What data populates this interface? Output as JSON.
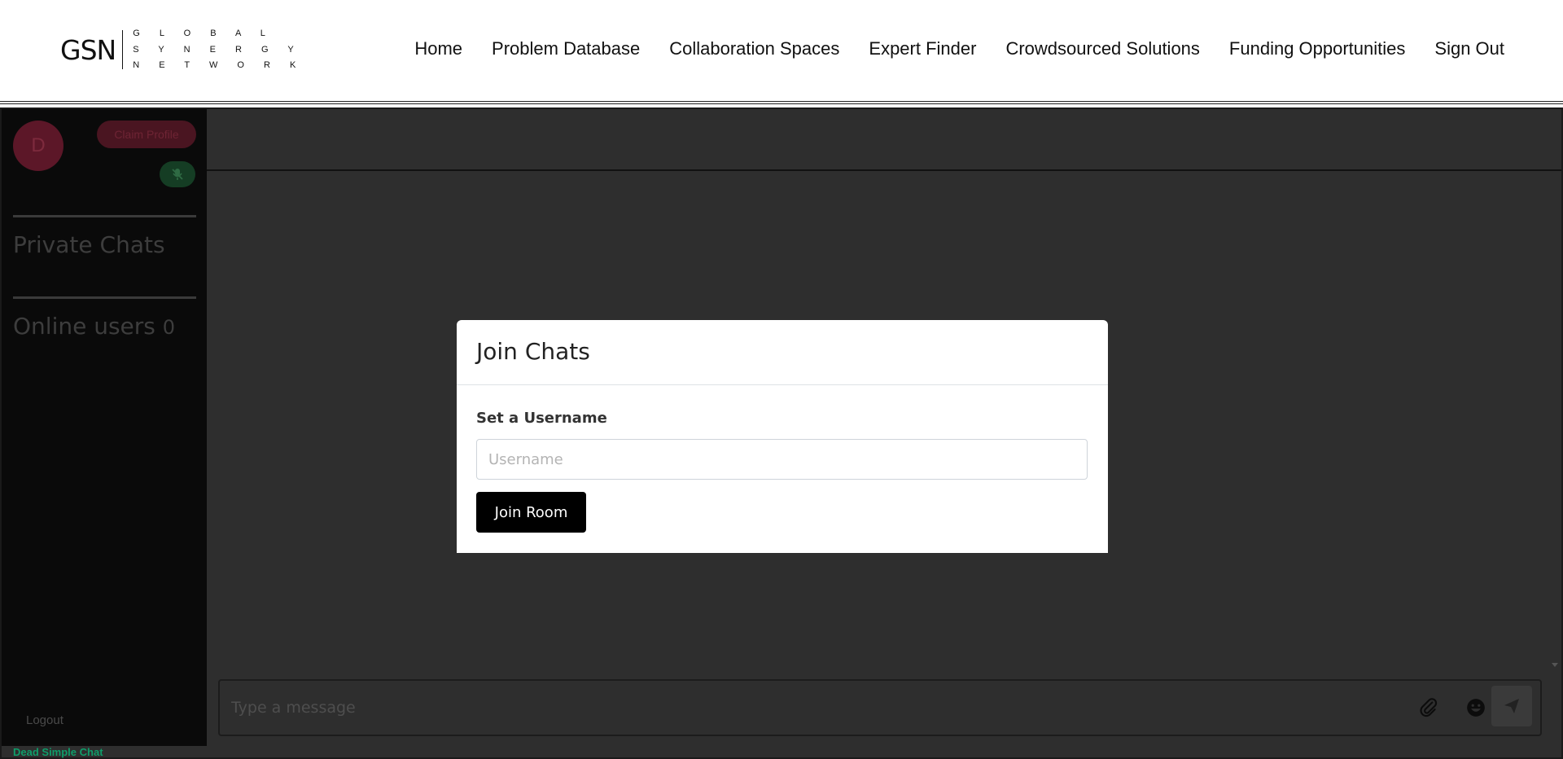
{
  "header": {
    "logo": {
      "abbr": "GSN",
      "words": [
        "G L O B A L",
        "S Y N E R G Y",
        "N E T W O R K"
      ]
    },
    "nav": [
      "Home",
      "Problem Database",
      "Collaboration Spaces",
      "Expert Finder",
      "Crowdsourced Solutions",
      "Funding Opportunities",
      "Sign Out"
    ]
  },
  "sidebar": {
    "avatar_letter": "D",
    "claim_profile": "Claim Profile",
    "private_chats": "Private Chats",
    "online_users_label": "Online users",
    "online_users_count": "0",
    "logout": "Logout",
    "brand": "Dead Simple Chat"
  },
  "composer": {
    "placeholder": "Type a message"
  },
  "modal": {
    "title": "Join Chats",
    "field_label": "Set a Username",
    "input_placeholder": "Username",
    "button": "Join Room"
  },
  "icons": {
    "mute": "microphone-slash-icon",
    "attach": "paperclip-icon",
    "emoji": "emoji-icon",
    "send": "send-icon"
  }
}
